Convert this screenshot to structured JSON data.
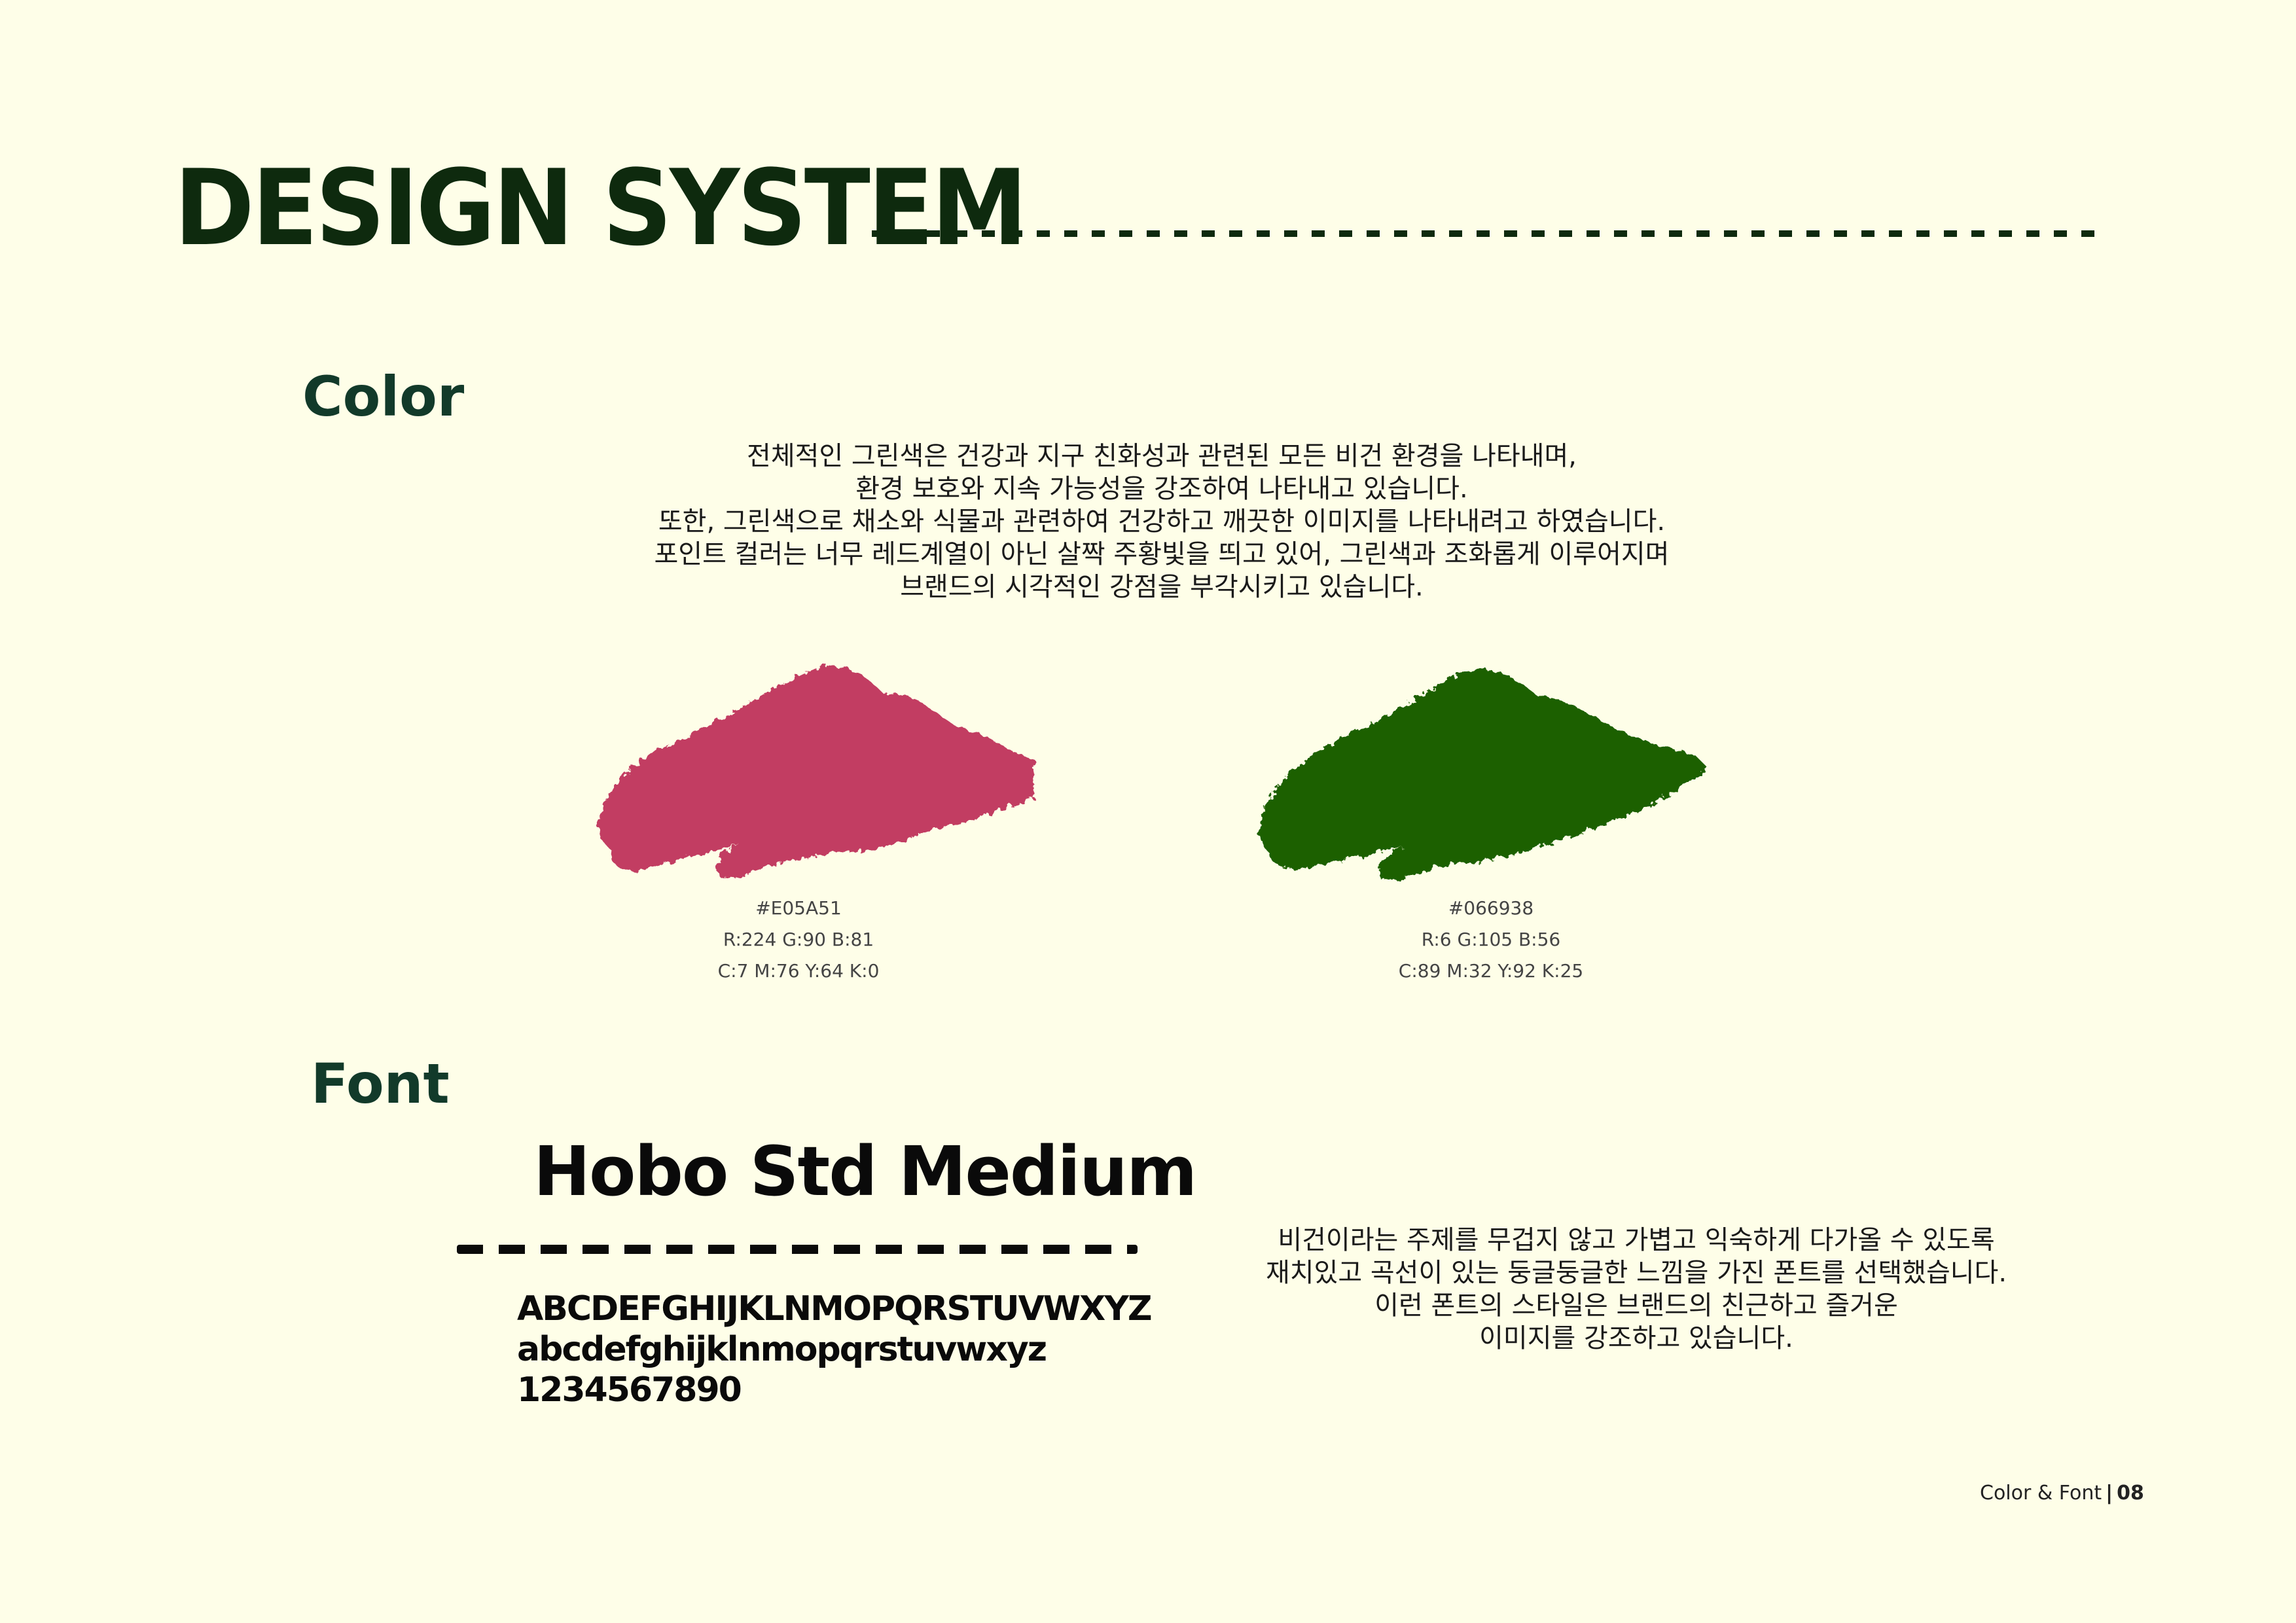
{
  "header": {
    "title": "DESIGN SYSTEM"
  },
  "color_section": {
    "heading": "Color",
    "description": [
      "전체적인 그린색은 건강과 지구 친화성과 관련된 모든 비건 환경을 나타내며,",
      "환경 보호와 지속 가능성을 강조하여 나타내고 있습니다.",
      "또한, 그린색으로 채소와 식물과 관련하여 건강하고 깨끗한 이미지를 나타내려고 하였습니다.",
      "포인트 컬러는 너무 레드계열이 아닌 살짝 주황빛을 띄고 있어, 그린색과 조화롭게 이루어지며",
      "브랜드의 시각적인 강점을 부각시키고 있습니다."
    ],
    "swatches": [
      {
        "hex": "#E05A51",
        "rgb": "R:224 G:90 B:81",
        "cmyk": "C:7  M:76  Y:64  K:0",
        "render_color": "#C23E62"
      },
      {
        "hex": "#066938",
        "rgb": "R:6 G:105 B:56",
        "cmyk": "C:89  M:32  Y:92  K:25",
        "render_color": "#1F6005"
      }
    ]
  },
  "font_section": {
    "heading": "Font",
    "font_name": "Hobo Std Medium",
    "glyphs_upper": "ABCDEFGHIJKLNMOPQRSTUVWXYZ",
    "glyphs_lower": "abcdefghijklnmopqrstuvwxyz",
    "glyphs_digits": "1234567890",
    "description": [
      "비건이라는 주제를 무겁지 않고 가볍고 익숙하게 다가올 수 있도록",
      "재치있고 곡선이 있는 둥글둥글한 느낌을 가진 폰트를 선택했습니다.",
      "이런 폰트의 스타일은 브랜드의 친근하고 즐거운",
      "이미지를 강조하고 있습니다."
    ]
  },
  "footer": {
    "label": "Color & Font",
    "separator": "|",
    "page": "08"
  }
}
